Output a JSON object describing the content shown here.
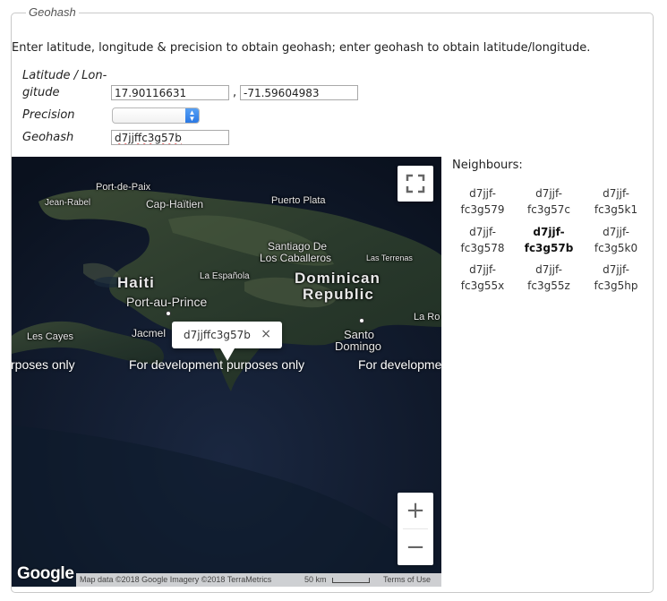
{
  "section": {
    "legend": "Geohash"
  },
  "intro": "Enter latitude, longitude & precision to obtain geohash; enter geohash to obtain latitude/longitude.",
  "form": {
    "latlon_label_line1": "Latitude / Lon-",
    "latlon_label_line2": "gitude",
    "latitude_value": "17.90116631",
    "comma": ",",
    "longitude_value": "-71.59604983",
    "precision_label": "Precision",
    "precision_value": "",
    "geohash_label": "Geohash",
    "geohash_value": "d7jjffc3g57b"
  },
  "map": {
    "places": {
      "port_de_paix": "Port-de-Paix",
      "jean_rabel": "Jean-Rabel",
      "cap_haitien": "Cap-Haïtien",
      "puerto_plata": "Puerto Plata",
      "santiago": "Santiago De",
      "los_caballeros": "Los Caballeros",
      "las_terrenas": "Las Terrenas",
      "haiti": "Haiti",
      "la_espanola": "La Española",
      "dominican": "Dominican",
      "republic": "Republic",
      "port_au_prince": "Port-au-Prince",
      "la_ro": "La Ro",
      "les_cayes": "Les Cayes",
      "jacmel": "Jacmel",
      "santo": "Santo",
      "domingo": "Domingo"
    },
    "watermark_left": "rposes only",
    "watermark_center": "For development purposes only",
    "watermark_right": "For developme",
    "popup_text": "d7jjffc3g57b",
    "popup_close": "×",
    "zoom_in": "+",
    "zoom_out": "−",
    "logo": "Google",
    "attribution": "Map data ©2018 Google Imagery ©2018 TerraMetrics",
    "scale": "50 km",
    "terms": "Terms of Use",
    "icons": {
      "fullscreen": "fullscreen-icon",
      "close": "close-icon"
    }
  },
  "neighbours": {
    "title": "Neighbours:",
    "cells": [
      {
        "l1": "d7jjf-",
        "l2": "fc3g579"
      },
      {
        "l1": "d7jjf-",
        "l2": "fc3g57c"
      },
      {
        "l1": "d7jjf-",
        "l2": "fc3g5k1"
      },
      {
        "l1": "d7jjf-",
        "l2": "fc3g578"
      },
      {
        "l1": "d7jjf-",
        "l2": "fc3g57b"
      },
      {
        "l1": "d7jjf-",
        "l2": "fc3g5k0"
      },
      {
        "l1": "d7jjf-",
        "l2": "fc3g55x"
      },
      {
        "l1": "d7jjf-",
        "l2": "fc3g55z"
      },
      {
        "l1": "d7jjf-",
        "l2": "fc3g5hp"
      }
    ]
  },
  "colors": {
    "ocean": "#0c1424",
    "land": "#2b3a2b",
    "accent": "#2a78e4"
  }
}
